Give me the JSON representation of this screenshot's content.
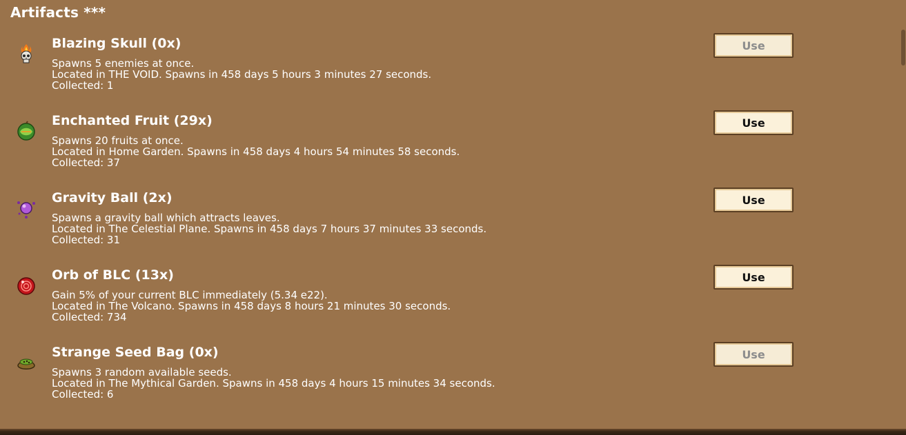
{
  "panel": {
    "title": "Artifacts ***"
  },
  "artifacts": [
    {
      "icon": "blazing-skull-icon",
      "name": "Blazing Skull (0x)",
      "description": "Spawns 5 enemies at once.",
      "location": "Located in THE VOID. Spawns in 458 days 5 hours 3 minutes 27 seconds.",
      "collected": "Collected: 1",
      "button_label": "Use",
      "button_enabled": false
    },
    {
      "icon": "enchanted-fruit-icon",
      "name": "Enchanted Fruit (29x)",
      "description": "Spawns 20 fruits at once.",
      "location": "Located in Home Garden. Spawns in 458 days 4 hours 54 minutes 58 seconds.",
      "collected": "Collected: 37",
      "button_label": "Use",
      "button_enabled": true
    },
    {
      "icon": "gravity-ball-icon",
      "name": "Gravity Ball (2x)",
      "description": "Spawns a gravity ball which attracts leaves.",
      "location": "Located in The Celestial Plane. Spawns in 458 days 7 hours 37 minutes 33 seconds.",
      "collected": "Collected: 31",
      "button_label": "Use",
      "button_enabled": true
    },
    {
      "icon": "orb-of-blc-icon",
      "name": "Orb of BLC (13x)",
      "description": "Gain 5% of your current BLC immediately (5.34 e22).",
      "location": "Located in The Volcano. Spawns in 458 days 8 hours 21 minutes 30 seconds.",
      "collected": "Collected: 734",
      "button_label": "Use",
      "button_enabled": true
    },
    {
      "icon": "strange-seed-bag-icon",
      "name": "Strange Seed Bag (0x)",
      "description": "Spawns 3 random available seeds.",
      "location": "Located in The Mythical Garden. Spawns in 458 days 4 hours 15 minutes 34 seconds.",
      "collected": "Collected: 6",
      "button_label": "Use",
      "button_enabled": false
    }
  ]
}
